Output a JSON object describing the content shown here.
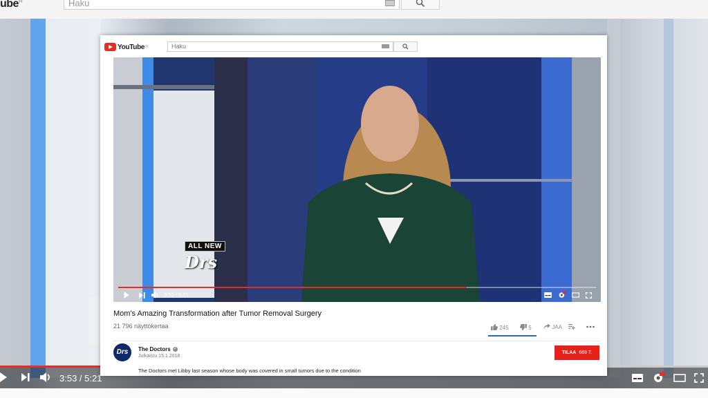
{
  "background": {
    "logo_text": "ube",
    "logo_region": "FI",
    "search_placeholder": "Haku",
    "time": "3:53 / 5:21",
    "hd_badge": "HD"
  },
  "header": {
    "logo_text": "YouTube",
    "logo_region": "FI",
    "search_placeholder": "Haku"
  },
  "player": {
    "overlay_badge_top": "ALL NEW",
    "overlay_badge_logo": "Drs",
    "time_current": "3:53",
    "time_total": "5:21",
    "time_separator": " / ",
    "progress_fraction": 0.73,
    "buffered_fraction": 0.73,
    "hd_badge": "HD"
  },
  "video": {
    "title": "Mom's Amazing Transformation after Tumor Removal Surgery",
    "views": "21 796 näyttökertaa",
    "likes": "245",
    "dislikes": "5",
    "share_label": "JAA"
  },
  "channel": {
    "name": "The Doctors",
    "avatar_text": "Drs",
    "published": "Julkaistu 15.1.2018",
    "subscribe_label": "TILAA",
    "subscriber_count": "669 T.",
    "description": "The Doctors met Libby last season whose body was covered in small tumors due to the condition"
  },
  "colors": {
    "accent": "#e52d27",
    "subscribe": "#e62117",
    "link_blue": "#2a6cb8"
  }
}
